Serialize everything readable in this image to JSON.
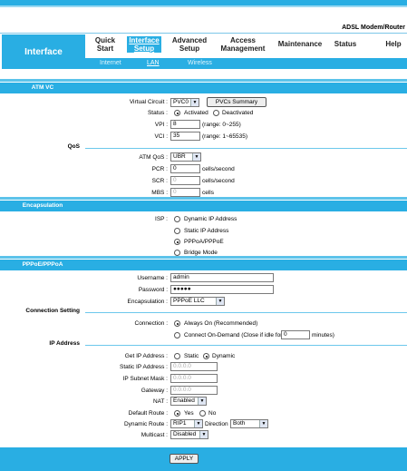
{
  "brand": "ADSL Modem/Router",
  "interface_label": "Interface",
  "tabs": [
    {
      "label": "Quick Start"
    },
    {
      "label": "Interface Setup"
    },
    {
      "label": "Advanced Setup"
    },
    {
      "label": "Access Management"
    },
    {
      "label": "Maintenance"
    },
    {
      "label": "Status"
    },
    {
      "label": "Help"
    }
  ],
  "subtabs": [
    {
      "label": "Internet"
    },
    {
      "label": "LAN"
    },
    {
      "label": "Wireless"
    }
  ],
  "sections": {
    "atm_vc": "ATM VC",
    "qos": "QoS",
    "encapsulation": "Encapsulation",
    "pppoe": "PPPoE/PPPoA",
    "connection_setting": "Connection Setting",
    "ip_address": "IP Address"
  },
  "atm": {
    "virtual_circuit_label": "Virtual Circuit :",
    "virtual_circuit_value": "PVC0",
    "pvcs_summary_button": "PVCs Summary",
    "status_label": "Status :",
    "status_activated": "Activated",
    "status_deactivated": "Deactivated",
    "vpi_label": "VPI :",
    "vpi_value": "8",
    "vpi_range": "(range: 0~255)",
    "vci_label": "VCI :",
    "vci_value": "35",
    "vci_range": "(range: 1~65535)"
  },
  "qos": {
    "atm_qos_label": "ATM QoS :",
    "atm_qos_value": "UBR",
    "pcr_label": "PCR :",
    "pcr_value": "0",
    "pcr_unit": "cells/second",
    "scr_label": "SCR :",
    "scr_value": "0",
    "scr_unit": "cells/second",
    "mbs_label": "MBS :",
    "mbs_value": "0",
    "mbs_unit": "cells"
  },
  "isp": {
    "label": "ISP :",
    "options": [
      "Dynamic IP Address",
      "Static IP Address",
      "PPPoA/PPPoE",
      "Bridge Mode"
    ],
    "selected_index": 2
  },
  "pppoe": {
    "username_label": "Username :",
    "username_value": "admin",
    "password_label": "Password :",
    "password_value": "●●●●●",
    "encapsulation_label": "Encapsulation :",
    "encapsulation_value": "PPPoE LLC"
  },
  "connection": {
    "label": "Connection :",
    "always_on": "Always On (Recommended)",
    "on_demand": "Connect On-Demand (Close if idle for",
    "idle_value": "0",
    "minutes": "minutes)"
  },
  "ip": {
    "get_ip_label": "Get IP Address :",
    "static": "Static",
    "dynamic": "Dynamic",
    "static_ip_label": "Static IP Address :",
    "static_ip_placeholder": "0.0.0.0",
    "subnet_label": "IP Subnet Mask :",
    "subnet_placeholder": "0.0.0.0",
    "gateway_label": "Gateway :",
    "gateway_placeholder": "0.0.0.0",
    "nat_label": "NAT :",
    "nat_value": "Enabled",
    "default_route_label": "Default Route :",
    "yes": "Yes",
    "no": "No",
    "dynamic_route_label": "Dynamic Route :",
    "dynamic_route_value": "RIP1",
    "direction_label": "Direction",
    "direction_value": "Both",
    "multicast_label": "Multicast :",
    "multicast_value": "Disabled"
  },
  "apply_button": "APPLY",
  "colors": {
    "accent": "#29aee3"
  }
}
